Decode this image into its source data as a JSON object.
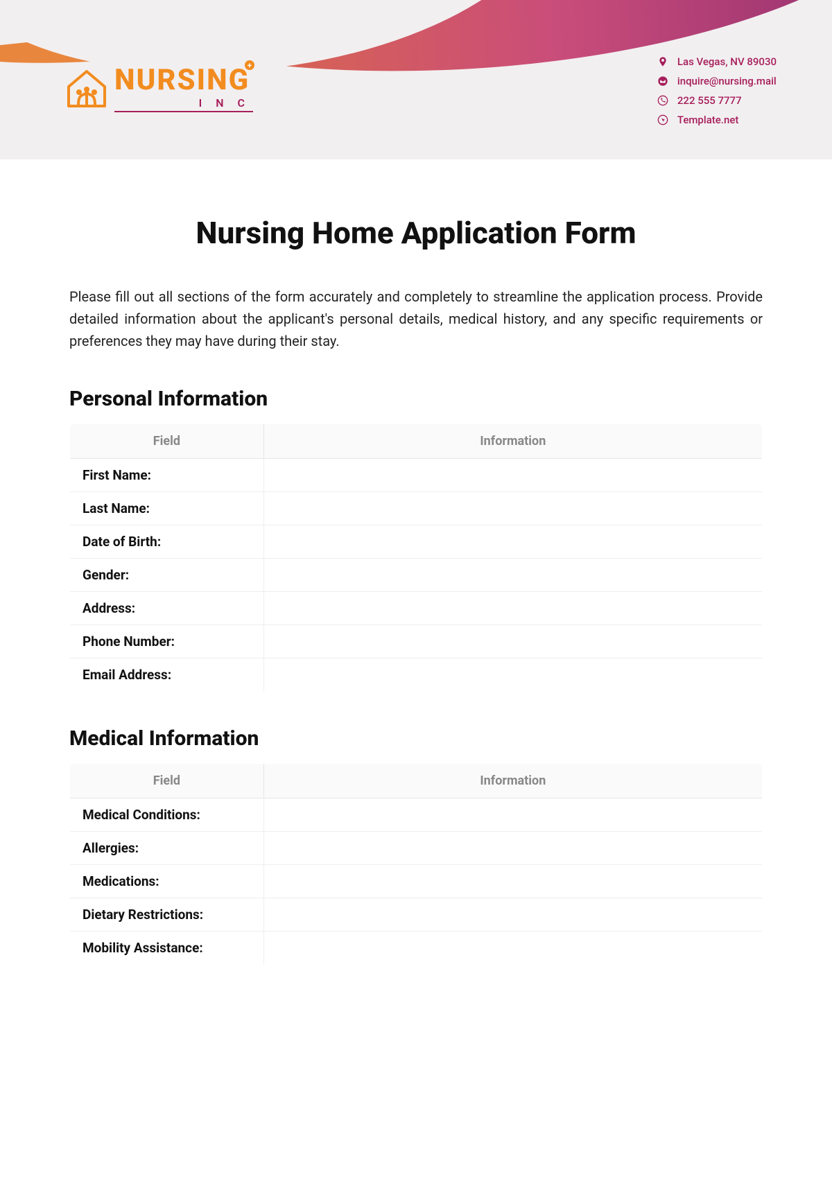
{
  "header": {
    "logo": {
      "word": "NURSING",
      "sub": "I N C"
    },
    "contacts": [
      {
        "icon": "location",
        "text": "Las Vegas, NV 89030"
      },
      {
        "icon": "mail",
        "text": "inquire@nursing.mail"
      },
      {
        "icon": "phone",
        "text": "222 555 7777"
      },
      {
        "icon": "cursor",
        "text": "Template.net"
      }
    ]
  },
  "title": "Nursing Home Application Form",
  "intro": "Please fill out all sections of the form accurately and completely to streamline the application process. Provide detailed information about the applicant's personal details, medical history, and any specific requirements or preferences they may have during their stay.",
  "tableHeaders": {
    "field": "Field",
    "info": "Information"
  },
  "sections": [
    {
      "title": "Personal Information",
      "rows": [
        {
          "label": "First Name:",
          "value": ""
        },
        {
          "label": "Last Name:",
          "value": ""
        },
        {
          "label": "Date of Birth:",
          "value": ""
        },
        {
          "label": "Gender:",
          "value": ""
        },
        {
          "label": "Address:",
          "value": ""
        },
        {
          "label": "Phone Number:",
          "value": ""
        },
        {
          "label": "Email Address:",
          "value": ""
        }
      ]
    },
    {
      "title": "Medical Information",
      "rows": [
        {
          "label": "Medical Conditions:",
          "value": ""
        },
        {
          "label": "Allergies:",
          "value": ""
        },
        {
          "label": "Medications:",
          "value": ""
        },
        {
          "label": "Dietary Restrictions:",
          "value": ""
        },
        {
          "label": "Mobility Assistance:",
          "value": ""
        }
      ]
    }
  ]
}
